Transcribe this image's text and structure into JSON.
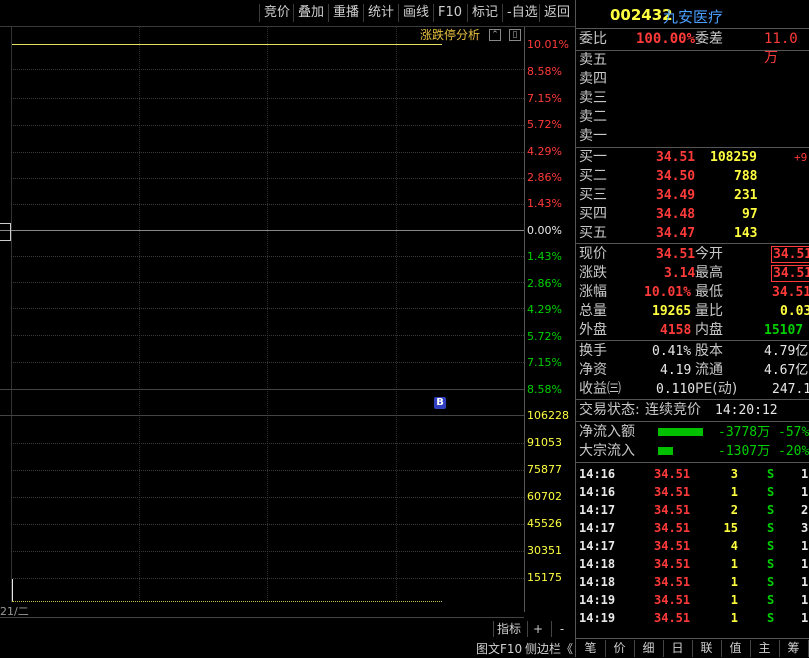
{
  "toolbar": {
    "buttons": [
      "竞价",
      "叠加",
      "重播",
      "统计",
      "画线",
      "F10",
      "标记",
      "-自选",
      "返回"
    ]
  },
  "chart": {
    "analysis_label": "涨跌停分析",
    "pct_labels_up": [
      "10.01%",
      "8.58%",
      "7.15%",
      "5.72%",
      "4.29%",
      "2.86%",
      "1.43%"
    ],
    "zero_label": "0.00%",
    "pct_labels_down": [
      "1.43%",
      "2.86%",
      "4.29%",
      "5.72%",
      "7.15%",
      "8.58%"
    ],
    "volume_labels": [
      "106228",
      "91053",
      "75877",
      "60702",
      "45526",
      "30351",
      "15175"
    ],
    "b_marker": "B",
    "date_label": "21/二",
    "bottom_buttons": [
      "指标",
      "+",
      "-"
    ],
    "footer_left": "图文F10",
    "footer_right": "侧边栏《"
  },
  "stock": {
    "code": "002432",
    "name": "九安医疗"
  },
  "order": {
    "weibi_label": "委比",
    "weibi_value": "100.00%",
    "weicha_label": "委差",
    "weicha_value": "11.0万",
    "sells": [
      "卖五",
      "卖四",
      "卖三",
      "卖二",
      "卖一"
    ],
    "buys": [
      {
        "label": "买一",
        "price": "34.51",
        "vol": "108259",
        "chg": "+9"
      },
      {
        "label": "买二",
        "price": "34.50",
        "vol": "788",
        "chg": ""
      },
      {
        "label": "买三",
        "price": "34.49",
        "vol": "231",
        "chg": ""
      },
      {
        "label": "买四",
        "price": "34.48",
        "vol": "97",
        "chg": ""
      },
      {
        "label": "买五",
        "price": "34.47",
        "vol": "143",
        "chg": ""
      }
    ]
  },
  "quote": {
    "rows": [
      {
        "l1": "现价",
        "v1": "34.51",
        "l2": "今开",
        "v2": "34.51"
      },
      {
        "l1": "涨跌",
        "v1": "3.14",
        "l2": "最高",
        "v2": "34.51"
      },
      {
        "l1": "涨幅",
        "v1": "10.01%",
        "l2": "最低",
        "v2": "34.51"
      },
      {
        "l1": "总量",
        "v1": "19265",
        "l2": "量比",
        "v2": "0.03"
      },
      {
        "l1": "外盘",
        "v1": "4158",
        "l2": "内盘",
        "v2": "15107"
      }
    ],
    "rows2": [
      {
        "l1": "换手",
        "v1": "0.41%",
        "l2": "股本",
        "v2": "4.79亿"
      },
      {
        "l1": "净资",
        "v1": "4.19",
        "l2": "流通",
        "v2": "4.67亿"
      },
      {
        "l1": "收益㈢",
        "v1": "0.110",
        "l2": "PE(动)",
        "v2": "247.1"
      }
    ],
    "status_label": "交易状态:",
    "status_value": "连续竞价",
    "status_time": "14:20:12"
  },
  "flow": [
    {
      "label": "净流入额",
      "value": "-3778万",
      "pct": "-57%",
      "bar": 0.57
    },
    {
      "label": "大宗流入",
      "value": "-1307万",
      "pct": "-20%",
      "bar": 0.2
    }
  ],
  "ticks": [
    {
      "time": "14:16",
      "price": "34.51",
      "vol": "3",
      "side": "S",
      "n": "1"
    },
    {
      "time": "14:16",
      "price": "34.51",
      "vol": "1",
      "side": "S",
      "n": "1"
    },
    {
      "time": "14:17",
      "price": "34.51",
      "vol": "2",
      "side": "S",
      "n": "2"
    },
    {
      "time": "14:17",
      "price": "34.51",
      "vol": "15",
      "side": "S",
      "n": "3"
    },
    {
      "time": "14:17",
      "price": "34.51",
      "vol": "4",
      "side": "S",
      "n": "1"
    },
    {
      "time": "14:18",
      "price": "34.51",
      "vol": "1",
      "side": "S",
      "n": "1"
    },
    {
      "time": "14:18",
      "price": "34.51",
      "vol": "1",
      "side": "S",
      "n": "1"
    },
    {
      "time": "14:19",
      "price": "34.51",
      "vol": "1",
      "side": "S",
      "n": "1"
    },
    {
      "time": "14:19",
      "price": "34.51",
      "vol": "1",
      "side": "S",
      "n": "1"
    }
  ],
  "tabs": [
    "笔",
    "价",
    "细",
    "日",
    "联",
    "值",
    "主",
    "筹"
  ]
}
